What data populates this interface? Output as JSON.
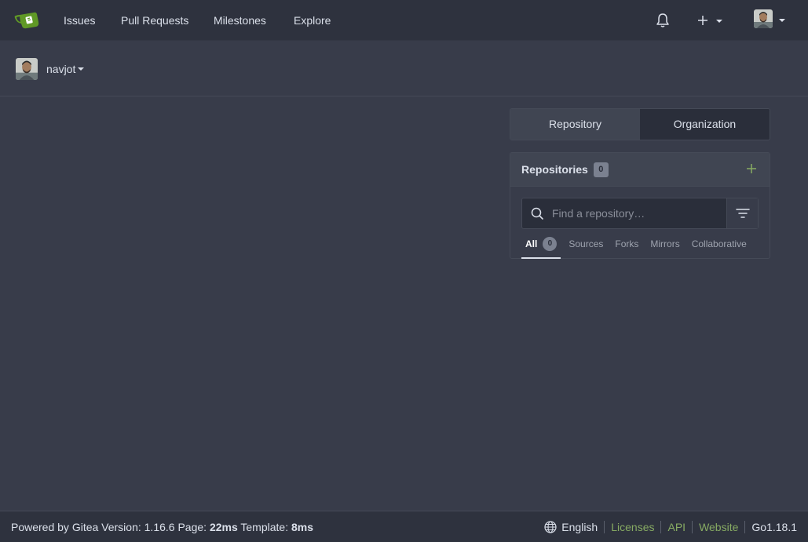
{
  "navbar": {
    "items": [
      {
        "label": "Issues"
      },
      {
        "label": "Pull Requests"
      },
      {
        "label": "Milestones"
      },
      {
        "label": "Explore"
      }
    ]
  },
  "dashboard": {
    "context_user": "navjot"
  },
  "switch": {
    "repository_label": "Repository",
    "organization_label": "Organization"
  },
  "repos": {
    "title": "Repositories",
    "count": "0",
    "search_placeholder": "Find a repository…",
    "tabs": [
      {
        "label": "All",
        "count": "0"
      },
      {
        "label": "Sources"
      },
      {
        "label": "Forks"
      },
      {
        "label": "Mirrors"
      },
      {
        "label": "Collaborative"
      }
    ]
  },
  "footer": {
    "powered_by": "Powered by Gitea Version: 1.16.6 Page: ",
    "page_time": "22ms",
    "template_label": " Template: ",
    "template_time": "8ms",
    "language": "English",
    "licenses": "Licenses",
    "api": "API",
    "website": "Website",
    "go_version": "Go1.18.1"
  },
  "colors": {
    "accent_green": "#87ab63",
    "background": "#383c4a",
    "navbar": "#2e323e"
  }
}
